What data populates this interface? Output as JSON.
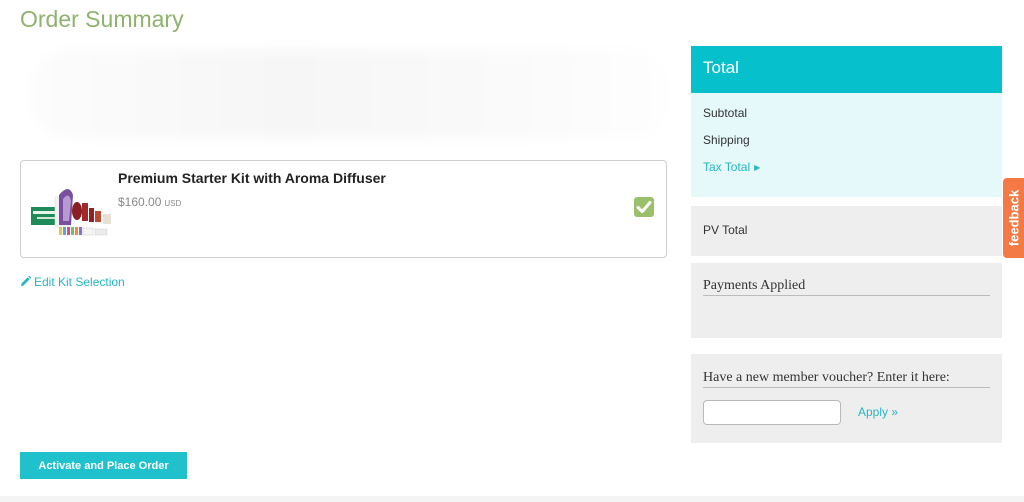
{
  "page": {
    "title": "Order Summary"
  },
  "kit": {
    "name": "Premium Starter Kit with Aroma Diffuser",
    "price": "$160.00",
    "currency": "USD",
    "selected": true,
    "image_icon": "starter-kit-product-image",
    "check_icon": "checkbox-checked-icon"
  },
  "edit_link": {
    "label": "Edit Kit Selection",
    "icon": "pencil-icon"
  },
  "actions": {
    "place_order_label": "Activate and Place Order"
  },
  "total": {
    "header": "Total",
    "subtotal_label": "Subtotal",
    "shipping_label": "Shipping",
    "tax_total_label": "Tax Total",
    "tax_arrow": "▶"
  },
  "pv": {
    "label": "PV Total"
  },
  "payments": {
    "heading": "Payments Applied"
  },
  "voucher": {
    "heading": "Have a new member voucher? Enter it here:",
    "input_value": "",
    "apply_label": "Apply »"
  },
  "feedback": {
    "label": "feedback"
  },
  "colors": {
    "title_green": "#8db36c",
    "accent_teal": "#06c0cb",
    "link_teal": "#26b5c6",
    "check_green": "#9bc06b",
    "feedback_orange": "#f47a45",
    "panel_gray": "#eeeeee",
    "total_body": "#e5f8fa"
  }
}
